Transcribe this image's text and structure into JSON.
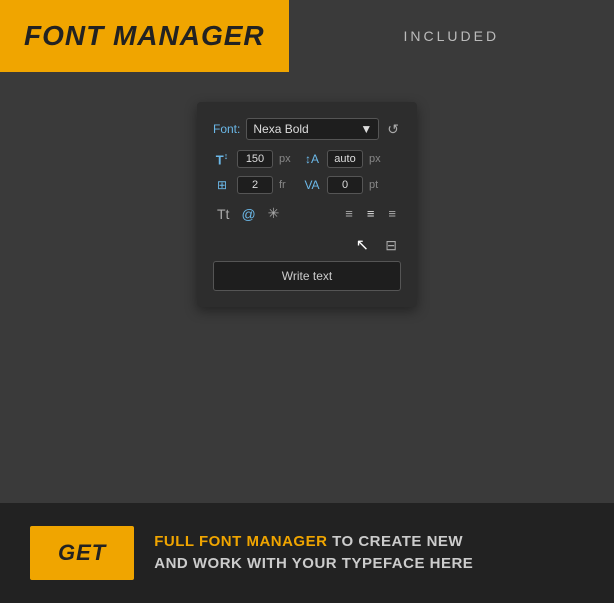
{
  "header": {
    "title": "FONT MANAGER",
    "badge": "INCLUDED"
  },
  "panel": {
    "font_label": "Font:",
    "font_name": "Nexa Bold",
    "size_value": "150",
    "size_unit": "px",
    "line_height_value": "auto",
    "line_height_unit": "px",
    "column_value": "2",
    "column_unit": "fr",
    "tracking_value": "0",
    "tracking_unit": "pt",
    "write_text_label": "Write text"
  },
  "bottom": {
    "get_label": "GET",
    "description_highlight": "FULL FONT MANAGER",
    "description_rest": " TO CREATE NEW\nAND WORK WITH YOUR TYPEFACE HERE"
  }
}
